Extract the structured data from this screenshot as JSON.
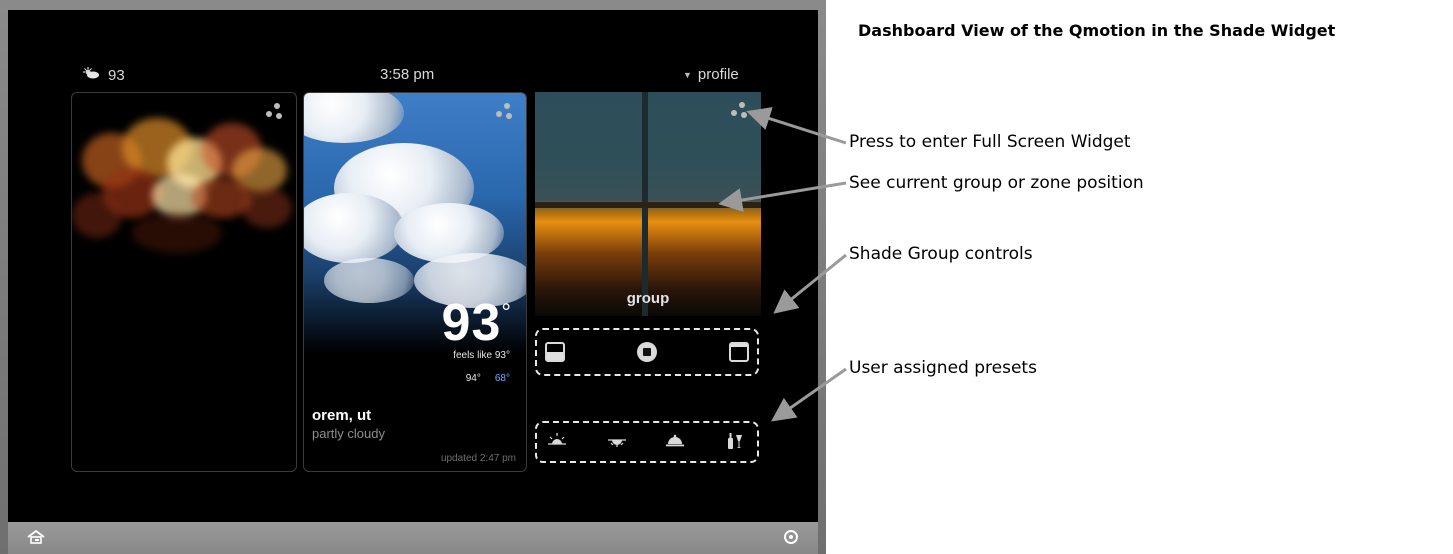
{
  "device": {
    "statusbar": {
      "weather_temp": "93",
      "time": "3:58 pm",
      "profile_label": "profile"
    },
    "weather_card": {
      "temperature": "93",
      "degree_symbol": "°",
      "feels_like": "feels like 93°",
      "high": "94°",
      "low": "68°",
      "city": "orem, ut",
      "condition": "partly cloudy",
      "updated": "updated 2:47 pm"
    },
    "shade_card": {
      "label": "group"
    },
    "icons": {
      "weather": "partly-sunny-icon",
      "profile_caret": "triangle-down-icon",
      "home": "home-icon",
      "settings": "settings-icon",
      "expand": "three-dots-icon",
      "shade_down": "shade-down-icon",
      "shade_stop": "stop-icon",
      "shade_up": "shade-up-icon",
      "preset_sunrise": "sunrise-icon",
      "preset_sunset": "sunset-icon",
      "preset_dinner": "dinner-cloche-icon",
      "preset_wine": "wine-icon"
    }
  },
  "annotations": {
    "title": "Dashboard View of the Qmotion in the Shade Widget",
    "full_screen": "Press to enter Full Screen Widget",
    "current_position": "See current group or zone position",
    "group_controls": "Shade Group controls",
    "presets": "User assigned presets"
  },
  "colors": {
    "screen_bg": "#000000",
    "frame": "#7a7a7a",
    "low_temp": "#7aa7ff",
    "annotation_arrow": "#9a9a9a"
  }
}
